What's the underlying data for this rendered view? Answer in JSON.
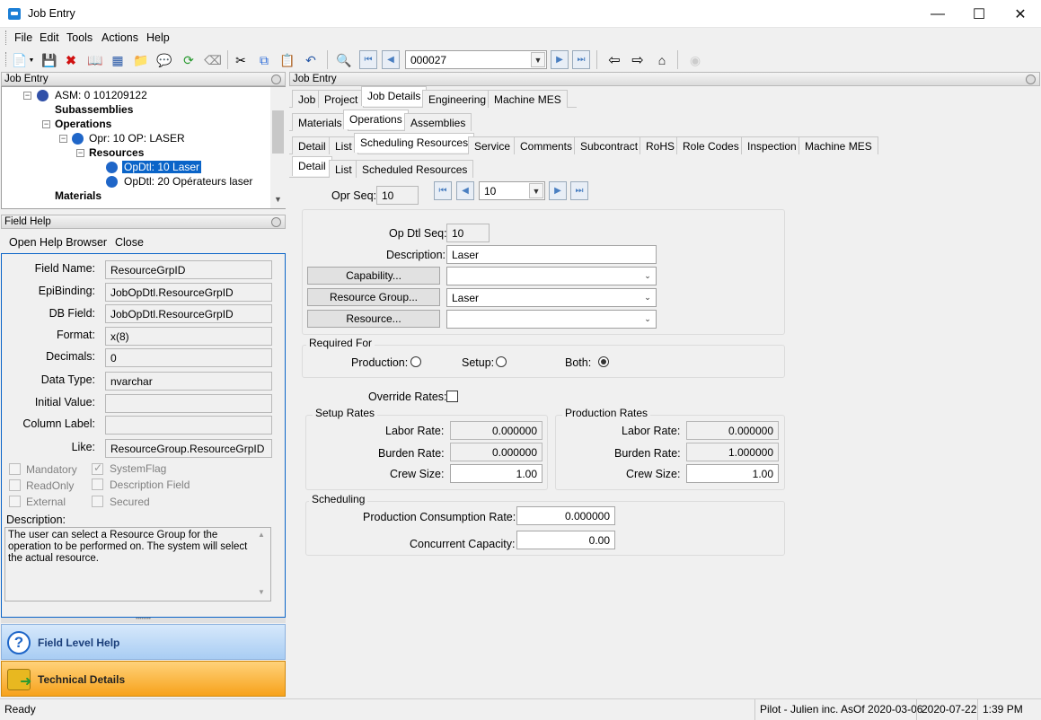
{
  "window": {
    "title": "Job Entry"
  },
  "menu": [
    "File",
    "Edit",
    "Tools",
    "Actions",
    "Help"
  ],
  "toolbar": {
    "job_number": "000027"
  },
  "left_top": {
    "header": "Job Entry",
    "tree": {
      "asm": "ASM: 0 101209122",
      "subassemblies": "Subassemblies",
      "operations": "Operations",
      "opr": "Opr: 10 OP: LASER",
      "resources": "Resources",
      "opdtl1": "OpDtl: 10 Laser",
      "opdtl2": "OpDtl: 20 Opérateurs laser",
      "materials": "Materials"
    }
  },
  "field_help": {
    "header": "Field Help",
    "open_browser": "Open Help Browser",
    "close": "Close",
    "labels": {
      "field_name": "Field Name:",
      "epibinding": "EpiBinding:",
      "db_field": "DB Field:",
      "format": "Format:",
      "decimals": "Decimals:",
      "data_type": "Data Type:",
      "initial_value": "Initial Value:",
      "column_label": "Column Label:",
      "like": "Like:"
    },
    "values": {
      "field_name": "ResourceGrpID",
      "epibinding": "JobOpDtl.ResourceGrpID",
      "db_field": "JobOpDtl.ResourceGrpID",
      "format": "x(8)",
      "decimals": "0",
      "data_type": "nvarchar",
      "initial_value": "",
      "column_label": "",
      "like": "ResourceGroup.ResourceGrpID"
    },
    "checks": {
      "mandatory": "Mandatory",
      "systemflag": "SystemFlag",
      "readonly": "ReadOnly",
      "description_field": "Description Field",
      "external": "External",
      "secured": "Secured"
    },
    "description_label": "Description:",
    "description": "The user can select a Resource Group for the operation to be performed on.  The system will select the actual resource.",
    "nav_field_level": "Field Level Help",
    "nav_technical": "Technical Details"
  },
  "right": {
    "header": "Job Entry",
    "tabs1": [
      "Job",
      "Project",
      "Job Details",
      "Engineering",
      "Machine MES"
    ],
    "tabs2": [
      "Materials",
      "Operations",
      "Assemblies"
    ],
    "tabs3": [
      "Detail",
      "List",
      "Scheduling Resources",
      "Service",
      "Comments",
      "Subcontract",
      "RoHS",
      "Role Codes",
      "Inspection",
      "Machine MES"
    ],
    "tabs4": [
      "Detail",
      "List",
      "Scheduled Resources"
    ],
    "opr_seq_label": "Opr Seq:",
    "opr_seq": "10",
    "nav_value": "10",
    "op_dtl_seq_label": "Op Dtl Seq:",
    "op_dtl_seq": "10",
    "description_label": "Description:",
    "description": "Laser",
    "capability_btn": "Capability...",
    "capability": "",
    "resource_group_btn": "Resource Group...",
    "resource_group": "Laser",
    "resource_btn": "Resource...",
    "resource": "",
    "required_for": "Required For",
    "production": "Production:",
    "setup": "Setup:",
    "both": "Both:",
    "override_rates": "Override Rates:",
    "setup_rates": "Setup Rates",
    "production_rates": "Production Rates",
    "labor_rate": "Labor Rate:",
    "burden_rate": "Burden Rate:",
    "crew_size": "Crew Size:",
    "setup_labor": "0.000000",
    "setup_burden": "0.000000",
    "setup_crew": "1.00",
    "prod_labor": "0.000000",
    "prod_burden": "1.000000",
    "prod_crew": "1.00",
    "scheduling": "Scheduling",
    "prod_consumption_label": "Production Consumption Rate:",
    "prod_consumption": "0.000000",
    "concurrent_label": "Concurrent Capacity:",
    "concurrent": "0.00"
  },
  "status": {
    "ready": "Ready",
    "company": "Pilot - Julien inc. AsOf 2020-03-06",
    "date": "2020-07-22",
    "time": "1:39 PM"
  }
}
